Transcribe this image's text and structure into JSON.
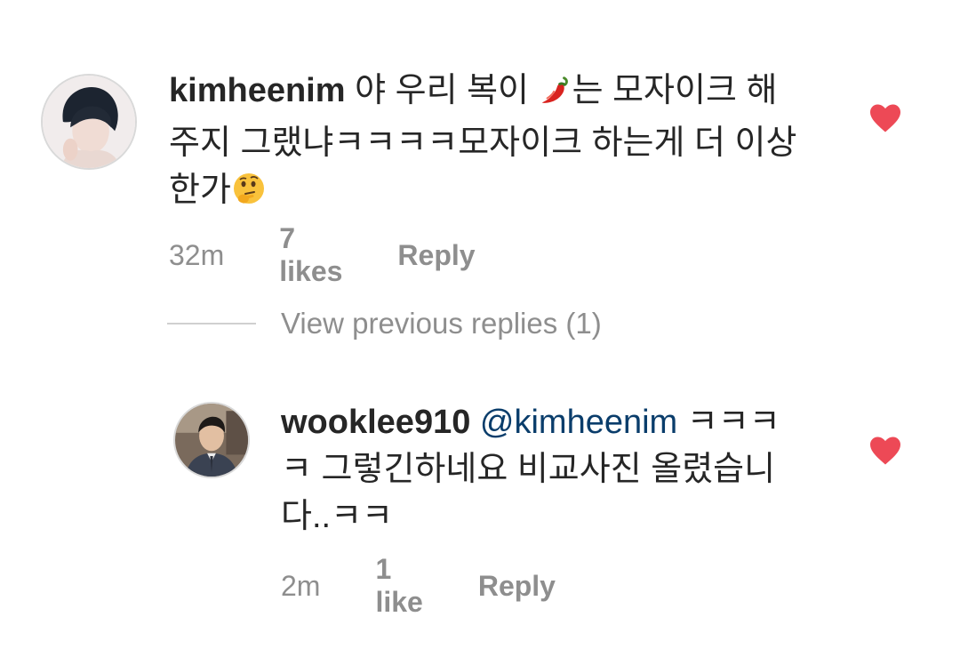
{
  "comments": [
    {
      "username": "kimheenim",
      "line1_before": " 야 우리 복이 ",
      "line1_emoji": "hot-pepper-icon",
      "line1_after": "는 모자이크 해",
      "line2": "주지 그랬냐ㅋㅋㅋㅋ모자이크 하는게 더 이상",
      "line3": "한가",
      "line3_emoji": "thinking-face-icon",
      "time": "32m",
      "likes": "7 likes",
      "reply": "Reply"
    },
    {
      "username": "wooklee910",
      "mention": "@kimheenim",
      "line1_after": " ㅋㅋㅋ",
      "line2": "ㅋ 그렇긴하네요 비교사진 올렸습니",
      "line3": "다..ㅋㅋ",
      "time": "2m",
      "likes": "1 like",
      "reply": "Reply"
    }
  ],
  "view_previous": "View previous replies (1)",
  "colors": {
    "heart": "#ed4956",
    "meta": "#8e8e8e",
    "mention": "#0a3d6b",
    "text": "#262626"
  }
}
